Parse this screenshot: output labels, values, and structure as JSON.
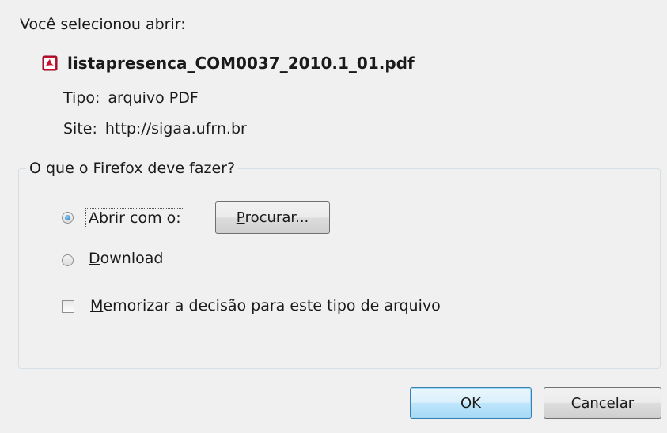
{
  "dialog": {
    "intro_text": "Você selecionou abrir:",
    "file_name": "listapresenca_COM0037_2010.1_01.pdf",
    "file_icon": "pdf-icon",
    "type_label": "Tipo:",
    "type_value": "arquivo PDF",
    "site_label": "Site:",
    "site_value": "http://sigaa.ufrn.br"
  },
  "action_group": {
    "legend": "O que o Firefox deve fazer?",
    "options": [
      {
        "label_first": "A",
        "label_rest": "brir com o:",
        "checked": true
      },
      {
        "label_first": "D",
        "label_rest": "ownload",
        "checked": false
      }
    ],
    "browse_first": "P",
    "browse_rest": "rocurar...",
    "remember_first": "M",
    "remember_rest": "emorizar a decisão para este tipo de arquivo",
    "remember_checked": false
  },
  "buttons": {
    "ok_label": "OK",
    "cancel_label": "Cancelar"
  },
  "colors": {
    "background": "#f0f0f0",
    "pdf_red": "#c8102e",
    "ok_border": "#3c7fb1"
  }
}
